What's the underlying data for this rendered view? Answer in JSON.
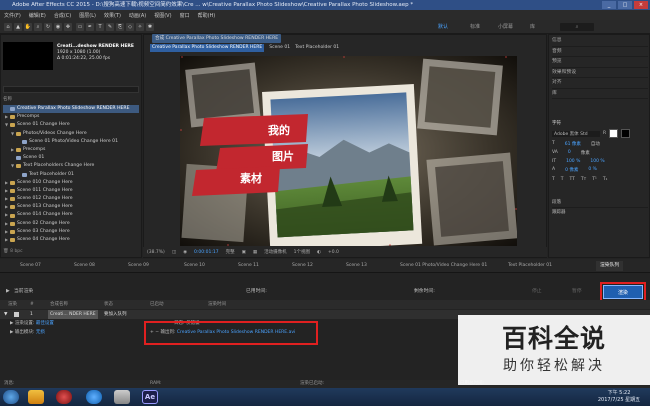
{
  "window": {
    "title": "Adobe After Effects CC 2015 - D:\\搜狗高速下载\\视频空间简约效果\\Cre ... w\\Creative Parallax Photo Slideshow\\Creative Parallax Photo Slideshow.aep *",
    "min": "_",
    "max": "□",
    "close": "×"
  },
  "menu": [
    "文件(F)",
    "编辑(E)",
    "合成(C)",
    "图层(L)",
    "效果(T)",
    "动画(A)",
    "视图(V)",
    "窗口",
    "帮助(H)"
  ],
  "workspaces": [
    "默认",
    "标准",
    "小屏幕",
    "库"
  ],
  "project": {
    "comp_name": "Creati...deshow RENDER HERE",
    "comp_size": "1920 x 1080 (1.00)",
    "comp_duration": "Δ 0:01:24:22, 25.00 fps",
    "search_placeholder": "",
    "column_name": "名称",
    "items": [
      {
        "label": "Creative Parallax Photo Slideshow RENDER HERE",
        "type": "comp",
        "indent": 0,
        "twirl": "",
        "selected": true
      },
      {
        "label": "Precomps",
        "type": "folder",
        "indent": 0,
        "twirl": "▶"
      },
      {
        "label": "Scene 01 Change Here",
        "type": "folder",
        "indent": 0,
        "twirl": "▼"
      },
      {
        "label": "Photos/Videos Change Here",
        "type": "folder",
        "indent": 1,
        "twirl": "▼"
      },
      {
        "label": "Scene 01 Photo/Video Change Here 01",
        "type": "comp",
        "indent": 2,
        "twirl": ""
      },
      {
        "label": "Precomps",
        "type": "folder",
        "indent": 1,
        "twirl": "▶"
      },
      {
        "label": "Scene 01",
        "type": "comp",
        "indent": 1,
        "twirl": ""
      },
      {
        "label": "Text Placeholders Change Here",
        "type": "folder",
        "indent": 1,
        "twirl": "▼"
      },
      {
        "label": "Text Placeholder 01",
        "type": "comp",
        "indent": 2,
        "twirl": ""
      },
      {
        "label": "Scene 010 Change Here",
        "type": "folder",
        "indent": 0,
        "twirl": "▶"
      },
      {
        "label": "Scene 011 Change Here",
        "type": "folder",
        "indent": 0,
        "twirl": "▶"
      },
      {
        "label": "Scene 012 Change Here",
        "type": "folder",
        "indent": 0,
        "twirl": "▶"
      },
      {
        "label": "Scene 013 Change Here",
        "type": "folder",
        "indent": 0,
        "twirl": "▶"
      },
      {
        "label": "Scene 014 Change Here",
        "type": "folder",
        "indent": 0,
        "twirl": "▶"
      },
      {
        "label": "Scene 02 Change Here",
        "type": "folder",
        "indent": 0,
        "twirl": "▶"
      },
      {
        "label": "Scene 03 Change Here",
        "type": "folder",
        "indent": 0,
        "twirl": "▶"
      },
      {
        "label": "Scene 04 Change Here",
        "type": "folder",
        "indent": 0,
        "twirl": "▶"
      }
    ],
    "footer": "8 bpc"
  },
  "viewer": {
    "tab": "合成 Creative Parallax Photo Slideshow RENDER HERE",
    "breadcrumbs": [
      "Creative Parallax Photo Slideshow RENDER HERE",
      "Scene 01",
      "Text Placeholder 01"
    ],
    "card_text": [
      "我的",
      "图片",
      "素材"
    ],
    "zoom": "(38.7%)",
    "timecode": "0:00:01:17",
    "resolution": "完整",
    "camera": "活动摄像机",
    "views": "1个视图",
    "exposure": "+0.0"
  },
  "right_panel": {
    "items": [
      "信息",
      "音频",
      "预览",
      "效果和预设",
      "对齐",
      "库"
    ],
    "char_title": "字符",
    "font": "Adobe 黑体 Std",
    "font_style": "R",
    "size": "61 像素",
    "leading": "自动",
    "tracking": "0",
    "stroke": "像素",
    "scale_v": "100 %",
    "scale_h": "100 %",
    "baseline": "0 像素",
    "tsume": "0 %",
    "style_buttons": [
      "T",
      "T",
      "TT",
      "Tт",
      "T¹",
      "T₁"
    ],
    "bottom_items": [
      "段落",
      "跟踪器"
    ]
  },
  "timeline": {
    "tabs": [
      "Scene 07",
      "Scene 08",
      "Scene 09",
      "Scene 10",
      "Scene 11",
      "Scene 12",
      "Scene 13",
      "Scene 01 Photo/Video Change Here 01",
      "Text Placeholder 01"
    ],
    "active_tab": "渲染队列",
    "current_render": "当前渲染",
    "elapsed": "已用时间:",
    "remaining": "剩余时间:",
    "stop": "停止",
    "pause": "暂停",
    "render": "渲染",
    "headers": [
      "渲染",
      "#",
      "合成名称",
      "状态",
      "已启动",
      "渲染时间"
    ],
    "item_index": "1",
    "item_comp": "Creati... NDER HERE",
    "item_status": "要加入队列",
    "render_settings_label": "渲染设置:",
    "render_settings_value": "最佳设置",
    "output_module_label": "输出模块:",
    "output_module_value": "无损",
    "log_label": "日志:",
    "log_value": "仅错误",
    "output_to_label": "输出到:",
    "output_to_value": "Creative Parallax Photo Slideshow RENDER HERE.avi"
  },
  "status": {
    "message": "消息:",
    "ram": "RAM:",
    "renders_started": "渲染已启动:",
    "total_elapsed": "已用总时间:"
  },
  "taskbar": {
    "time": "下午 5:22",
    "date": "2017/7/25 星期五",
    "ae_label": "Ae"
  },
  "watermark": {
    "line1": "百科全说",
    "line2": "助你轻松解决"
  },
  "colors": {
    "accent": "#4aa3ff",
    "highlight_red": "#e02020",
    "ribbon_red": "#c2272f"
  }
}
